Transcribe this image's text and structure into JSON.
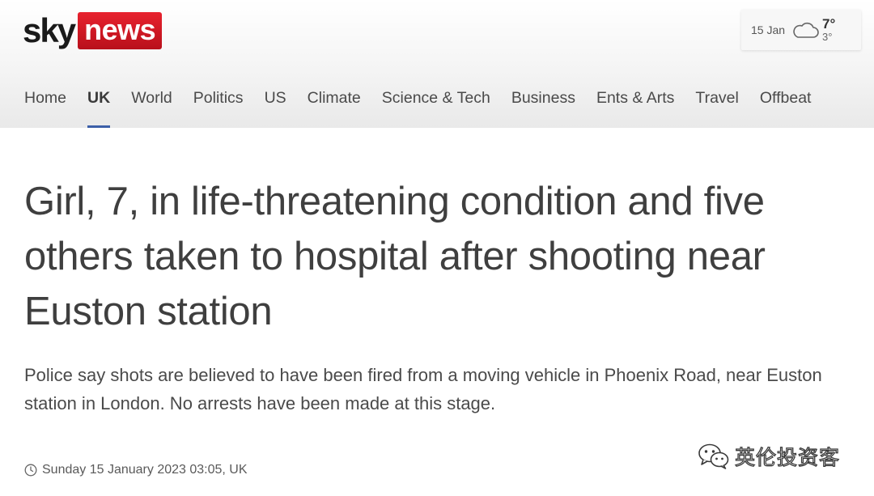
{
  "header": {
    "logo": {
      "sky": "sky",
      "news": "news",
      "brand_color": "#d0121c"
    },
    "weather": {
      "date": "15 Jan",
      "icon": "cloud-icon",
      "high": "7°",
      "low": "3°"
    }
  },
  "nav": {
    "items": [
      {
        "label": "Home"
      },
      {
        "label": "UK",
        "active": true
      },
      {
        "label": "World"
      },
      {
        "label": "Politics"
      },
      {
        "label": "US"
      },
      {
        "label": "Climate"
      },
      {
        "label": "Science & Tech"
      },
      {
        "label": "Business"
      },
      {
        "label": "Ents & Arts"
      },
      {
        "label": "Travel"
      },
      {
        "label": "Offbeat"
      }
    ],
    "active_color": "#3c5fa8"
  },
  "article": {
    "headline": "Girl, 7, in life-threatening condition and five others taken to hospital after shooting near Euston station",
    "standfirst": "Police say shots are believed to have been fired from a moving vehicle in Phoenix Road, near Euston station in London. No arrests have been made at this stage.",
    "timestamp": "Sunday 15 January 2023 03:05, UK",
    "timestamp_icon": "clock-icon"
  },
  "watermark": {
    "icon": "wechat-icon",
    "text": "英伦投资客"
  }
}
